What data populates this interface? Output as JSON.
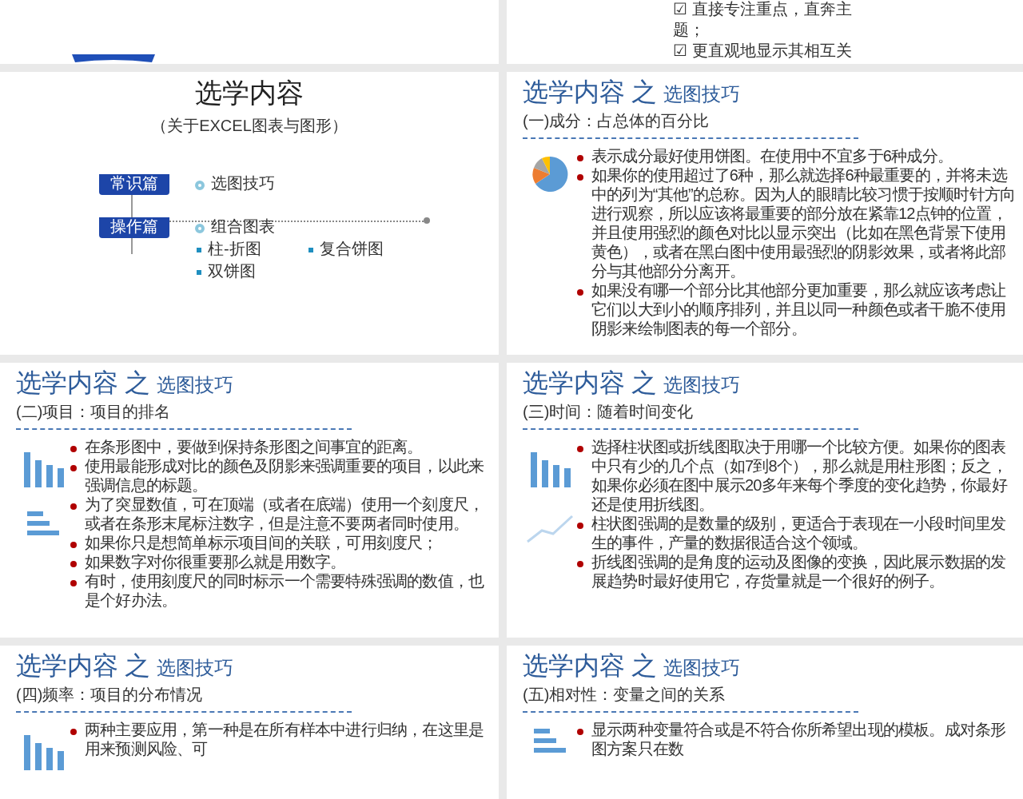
{
  "slides": [
    {
      "kind": "ribbon"
    },
    {
      "kind": "checklist",
      "lines": [
        "☑ 直接专注重点，直奔主",
        "题；",
        "☑ 更直观地显示其相互关"
      ]
    },
    {
      "kind": "toc",
      "title": "选学内容",
      "subtitle": "（关于EXCEL图表与图形）",
      "sections": [
        {
          "label": "常识篇",
          "items": [
            {
              "kind": "topic",
              "text": "选图技巧"
            }
          ]
        },
        {
          "label": "操作篇",
          "items": [
            {
              "kind": "topic",
              "text": "组合图表"
            },
            {
              "kind": "sub",
              "text": "柱-折图"
            },
            {
              "kind": "sub",
              "text": "复合饼图"
            },
            {
              "kind": "sub",
              "text": "双饼图"
            }
          ]
        }
      ]
    },
    {
      "kind": "content",
      "title": "选学内容",
      "joiner": "之",
      "topic": "选图技巧",
      "heading": "(一)成分：占总体的百分比",
      "icons": [
        {
          "kind": "pie"
        }
      ],
      "bullets": [
        "表示成分最好使用饼图。在使用中不宜多于6种成分。",
        "如果你的使用超过了6种，那么就选择6种最重要的，并将未选中的列为“其他”的总称。因为人的眼睛比较习惯于按顺时针方向进行观察，所以应该将最重要的部分放在紧靠12点钟的位置，并且使用强烈的颜色对比以显示突出（比如在黑色背景下使用黄色），或者在黑白图中使用最强烈的阴影效果，或者将此部分与其他部分分离开。",
        "如果没有哪一个部分比其他部分更加重要，那么就应该考虑让它们以大到小的顺序排列，并且以同一种颜色或者干脆不使用阴影来绘制图表的每一个部分。"
      ]
    },
    {
      "kind": "content",
      "title": "选学内容",
      "joiner": "之",
      "topic": "选图技巧",
      "heading": "(二)项目：项目的排名",
      "icons": [
        {
          "kind": "columns"
        },
        {
          "kind": "hbars"
        }
      ],
      "bullets": [
        "在条形图中，要做到保持条形图之间事宜的距离。",
        "使用最能形成对比的颜色及阴影来强调重要的项目，以此来强调信息的标题。",
        "为了突显数值，可在顶端（或者在底端）使用一个刻度尺，或者在条形末尾标注数字，但是注意不要两者同时使用。",
        "如果你只是想简单标示项目间的关联，可用刻度尺；",
        "如果数字对你很重要那么就是用数字。",
        "有时，使用刻度尺的同时标示一个需要特殊强调的数值，也是个好办法。"
      ]
    },
    {
      "kind": "content",
      "title": "选学内容",
      "joiner": "之",
      "topic": "选图技巧",
      "heading": "(三)时间：随着时间变化",
      "icons": [
        {
          "kind": "columns"
        },
        {
          "kind": "line"
        }
      ],
      "bullets": [
        "选择柱状图或折线图取决于用哪一个比较方便。如果你的图表中只有少的几个点（如7到8个），那么就是用柱形图；反之，如果你必须在图中展示20多年来每个季度的变化趋势，你最好还是使用折线图。",
        "柱状图强调的是数量的级别，更适合于表现在一小段时间里发生的事件，产量的数据很适合这个领域。",
        "折线图强调的是角度的运动及图像的变换，因此展示数据的发展趋势时最好使用它，存货量就是一个很好的例子。"
      ]
    },
    {
      "kind": "content",
      "title": "选学内容",
      "joiner": "之",
      "topic": "选图技巧",
      "heading": "(四)频率：项目的分布情况",
      "icons": [
        {
          "kind": "columns"
        }
      ],
      "bullets": [
        "两种主要应用，第一种是在所有样本中进行归纳，在这里是用来预测风险、可"
      ]
    },
    {
      "kind": "content",
      "title": "选学内容",
      "joiner": "之",
      "topic": "选图技巧",
      "heading": "(五)相对性：变量之间的关系",
      "icons": [
        {
          "kind": "hbars"
        }
      ],
      "bullets": [
        "显示两种变量符合或是不符合你所希望出现的模板。成对条形图方案只在数"
      ]
    }
  ]
}
